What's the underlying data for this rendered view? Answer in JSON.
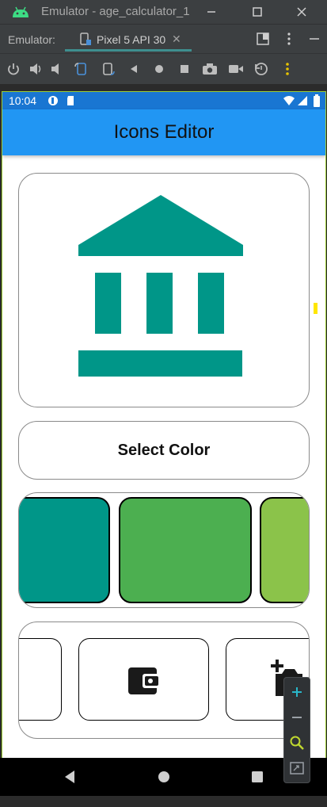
{
  "window": {
    "title": "Emulator - age_calculator_1"
  },
  "tabs": {
    "label": "Emulator:",
    "active_tab": "Pixel 5 API 30"
  },
  "toolbar_icons": [
    "power-icon",
    "volume-up-icon",
    "volume-down-icon",
    "rotate-left-icon",
    "rotate-right-icon",
    "back-icon",
    "home-icon",
    "overview-icon",
    "camera-icon",
    "video-icon",
    "replay-icon",
    "more-icon"
  ],
  "statusbar": {
    "time": "10:04"
  },
  "app": {
    "title": "Icons Editor",
    "select_color_label": "Select Color",
    "preview_icon": "bank-icon",
    "preview_color": "#009688",
    "swatches": [
      "#009688",
      "#4caf50",
      "#8bc34a"
    ],
    "icon_options": [
      "wallet-icon",
      "add-photo-icon"
    ]
  },
  "colors": {
    "appbar": "#2196f3",
    "statusbar": "#1976d2",
    "ide_bg": "#3c3f41",
    "accent_border": "#9ccc34"
  }
}
